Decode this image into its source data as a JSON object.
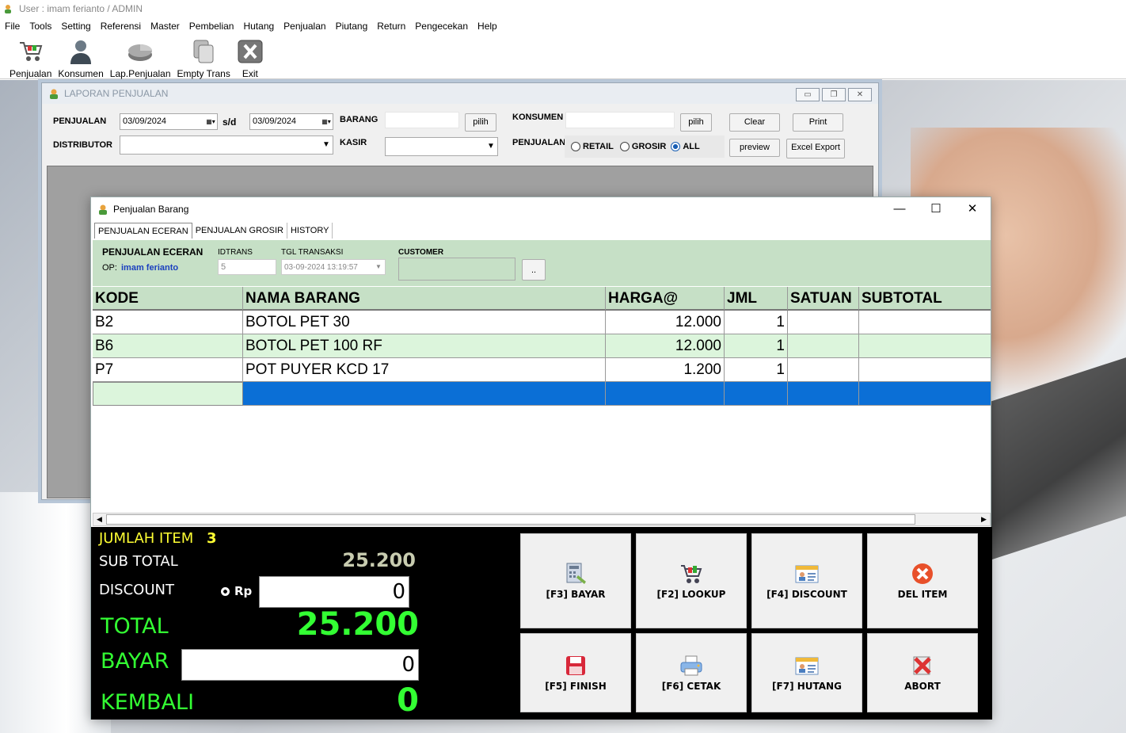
{
  "app": {
    "title": "User : imam ferianto / ADMIN"
  },
  "menu": [
    "File",
    "Tools",
    "Setting",
    "Referensi",
    "Master",
    "Pembelian",
    "Hutang",
    "Penjualan",
    "Piutang",
    "Return",
    "Pengecekan",
    "Help"
  ],
  "toolbar": [
    {
      "label": "Penjualan",
      "icon": "cart-icon"
    },
    {
      "label": "Konsumen",
      "icon": "user-icon"
    },
    {
      "label": "Lap.Penjualan",
      "icon": "chart-icon"
    },
    {
      "label": "Empty Trans",
      "icon": "copy-icon"
    },
    {
      "label": "Exit",
      "icon": "exit-icon"
    }
  ],
  "laporan": {
    "title": "LAPORAN PENJUALAN",
    "penjualan_label": "PENJUALAN",
    "date_from": "03/09/2024",
    "sd_label": "s/d",
    "date_to": "03/09/2024",
    "barang_label": "BARANG",
    "pilih": "pilih",
    "konsumen_label": "KONSUMEN",
    "clear": "Clear",
    "print": "Print",
    "distributor_label": "DISTRIBUTOR",
    "kasir_label": "KASIR",
    "penjualan2_label": "PENJUALAN",
    "retail": "RETAIL",
    "grosir": "GROSIR",
    "all": "ALL",
    "preview": "preview",
    "excel": "Excel Export"
  },
  "pb": {
    "title": "Penjualan Barang",
    "tabs": [
      "PENJUALAN ECERAN",
      "PENJUALAN GROSIR",
      "HISTORY"
    ],
    "mode": "PENJUALAN ECERAN",
    "op_label": "OP:",
    "op_name": "imam ferianto",
    "idtrans_label": "IDTRANS",
    "idtrans": "5",
    "tgl_label": "TGL TRANSAKSI",
    "tgl": "03-09-2024 13:19:57",
    "customer_label": "CUSTOMER",
    "customer_btn": "..",
    "columns": [
      "KODE",
      "NAMA BARANG",
      "HARGA@",
      "JML",
      "SATUAN",
      "SUBTOTAL"
    ],
    "rows": [
      [
        "B2",
        "BOTOL PET 30",
        "12.000",
        "1",
        "",
        ""
      ],
      [
        "B6",
        "BOTOL PET 100 RF",
        "12.000",
        "1",
        "",
        ""
      ],
      [
        "P7",
        "POT PUYER KCD 17",
        "1.200",
        "1",
        "",
        ""
      ]
    ],
    "summary": {
      "jumlah_item_label": "JUMLAH ITEM",
      "jumlah_item": "3",
      "sub_total_label": "SUB TOTAL",
      "sub_total": "25.200",
      "discount_label": "DISCOUNT",
      "rp_label": "Rp",
      "discount": "0",
      "total_label": "TOTAL",
      "total": "25.200",
      "bayar_label": "BAYAR",
      "bayar": "0",
      "kembali_label": "KEMBALI",
      "kembali": "0"
    },
    "buttons": [
      {
        "label": "[F3] BAYAR",
        "icon": "calculator-icon"
      },
      {
        "label": "[F2] LOOKUP",
        "icon": "cart-icon"
      },
      {
        "label": "[F4] DISCOUNT",
        "icon": "id-card-icon"
      },
      {
        "label": "DEL ITEM",
        "icon": "delete-icon"
      },
      {
        "label": "[F5] FINISH",
        "icon": "save-icon"
      },
      {
        "label": "[F6] CETAK",
        "icon": "printer-icon"
      },
      {
        "label": "[F7] HUTANG",
        "icon": "id-card-icon"
      },
      {
        "label": "ABORT",
        "icon": "abort-icon"
      }
    ]
  }
}
